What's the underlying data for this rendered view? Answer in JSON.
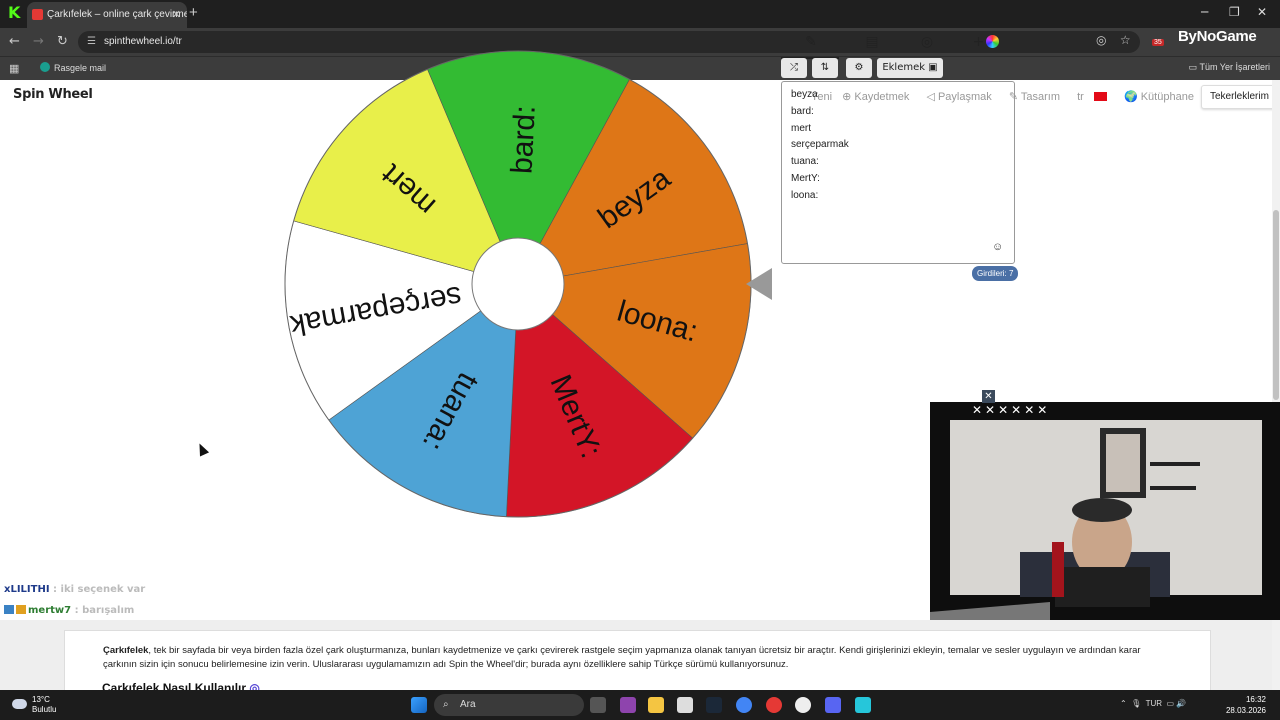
{
  "browser": {
    "tab_title": "Çarkıfelek – online çark çevirme",
    "url": "spinthewheel.io/tr",
    "bookmark_1": "Rasgele mail",
    "bookmarks_all": "Tüm Yer İşaretleri",
    "extension_badge": "35",
    "brand": "ByNoGame"
  },
  "site": {
    "logo": "Spin Wheel",
    "nav": {
      "new": "Yeni",
      "save": "Kaydetmek",
      "share": "Paylaşmak",
      "design": "Tasarım",
      "lang": "tr",
      "library": "Kütüphane"
    },
    "my_wheels": "Tekerleklerim"
  },
  "wheel": {
    "segments": [
      {
        "label": "beyza",
        "color": "#de7617"
      },
      {
        "label": "loona:",
        "color": "#de7617"
      },
      {
        "label": "MertY:",
        "color": "#d31527"
      },
      {
        "label": "tuana:",
        "color": "#4ea3d5"
      },
      {
        "label": "serçeparmak",
        "color": "#ffffff"
      },
      {
        "label": "mert",
        "color": "#e8ef4a"
      },
      {
        "label": "bard:",
        "color": "#33bb33"
      }
    ]
  },
  "editor": {
    "add_button": "Eklemek",
    "entries": [
      "beyza",
      "bard:",
      "mert",
      "serçeparmak",
      "tuana:",
      "MertY:",
      "loona:"
    ],
    "entries_count": "Girdileri: 7"
  },
  "chat": [
    {
      "user": "xLILITHI",
      "message": ": iki seçenek var"
    },
    {
      "user": "mertw7",
      "message": ": barışalım"
    }
  ],
  "description": {
    "bold_lead": "Çarkıfelek",
    "text": ", tek bir sayfada bir veya birden fazla özel çark oluşturmanıza, bunları kaydetmenize ve çarkı çevirerek rastgele seçim yapmanıza olanak tanıyan ücretsiz bir araçtır. Kendi girişlerinizi ekleyin, temalar ve sesler uygulayın ve ardından karar çarkının sizin için sonucu belirlemesine izin verin. Uluslararası uygulamamızın adı Spin the Wheel'dir; burada aynı özelliklere sahip Türkçe sürümü kullanıyorsunuz.",
    "heading": "Çarkıfelek Nasıl Kullanılır"
  },
  "taskbar": {
    "temp": "13°C",
    "weather": "Bulutlu",
    "search": "Ara",
    "lang": "TUR",
    "time": "16:32",
    "date": "28.03.2026"
  }
}
